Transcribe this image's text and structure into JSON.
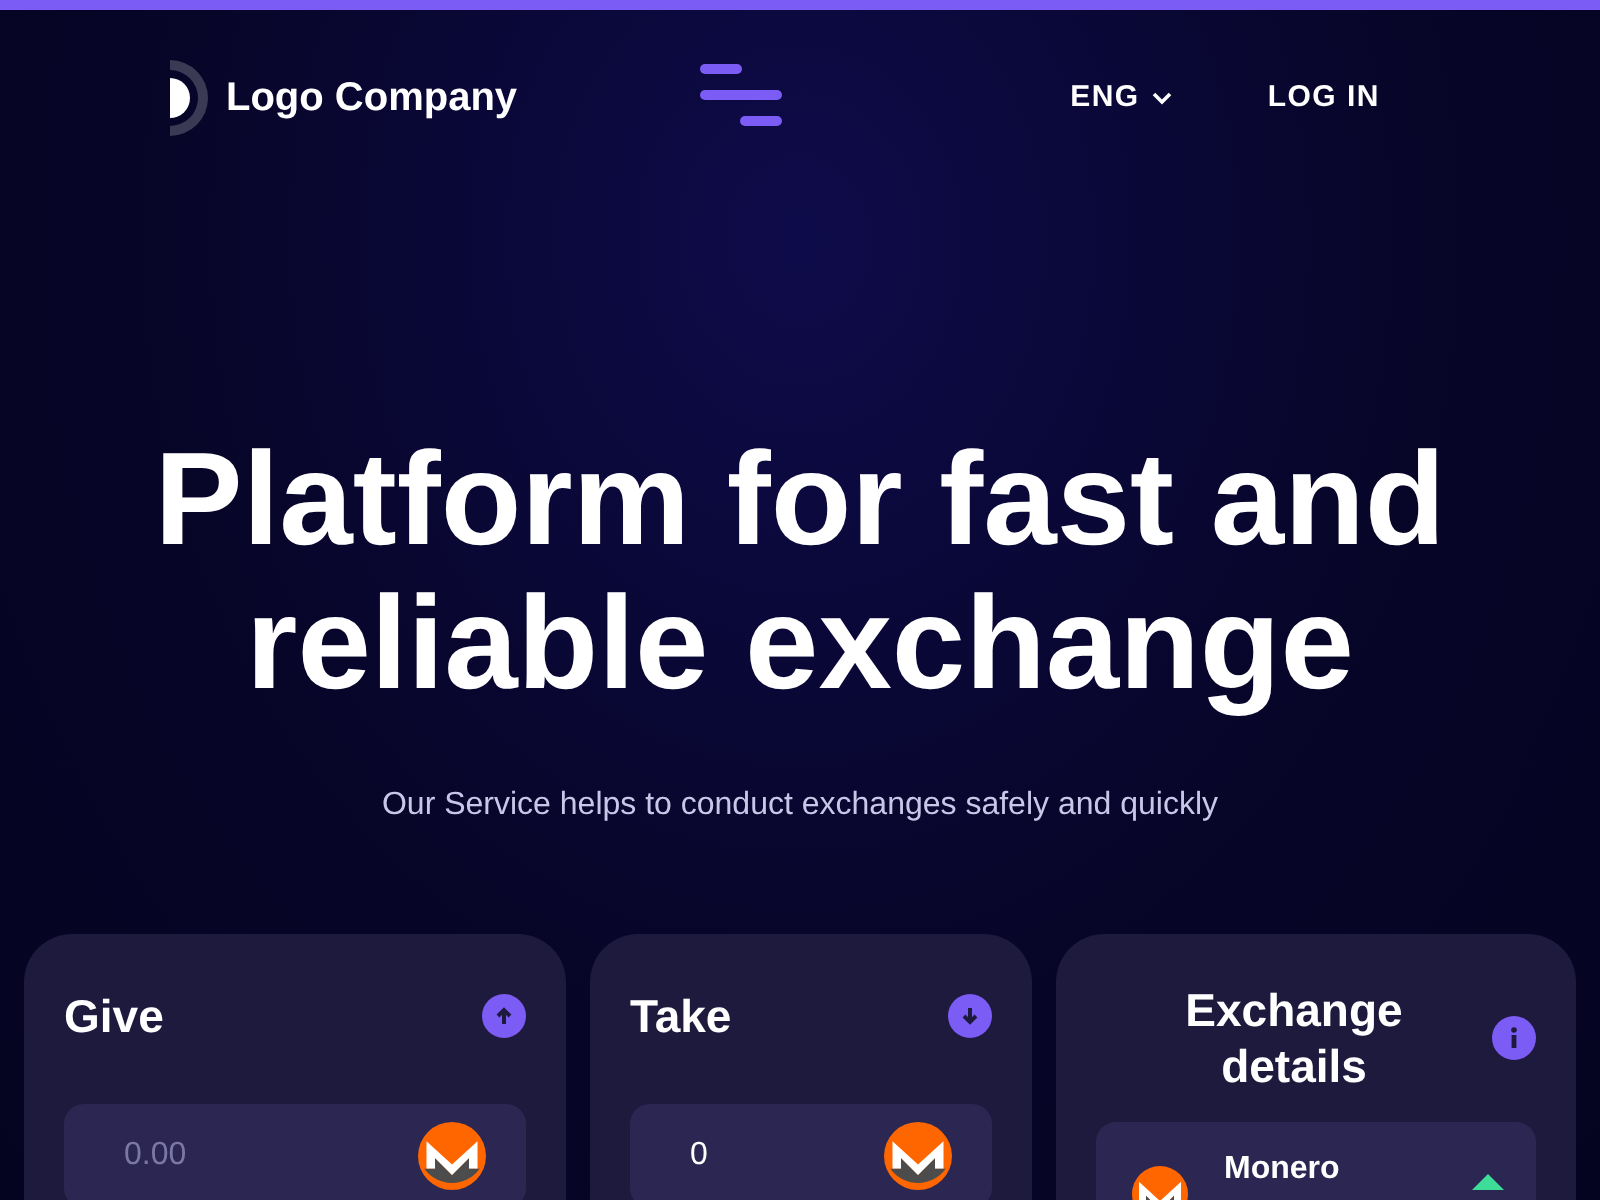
{
  "header": {
    "logo_text": "Logo Company",
    "language": "ENG",
    "login": "LOG IN"
  },
  "hero": {
    "title_lines": [
      "Platform for fast and",
      "reliable exchange"
    ],
    "subtitle": "Our Service helps to conduct exchanges safely and quickly"
  },
  "give": {
    "title": "Give",
    "field": {
      "placeholder": "0.00"
    }
  },
  "take": {
    "title": "Take",
    "field": {
      "value": "0"
    }
  },
  "details": {
    "title_lines": [
      "Exchange",
      "details"
    ],
    "currency": "Monero"
  }
}
